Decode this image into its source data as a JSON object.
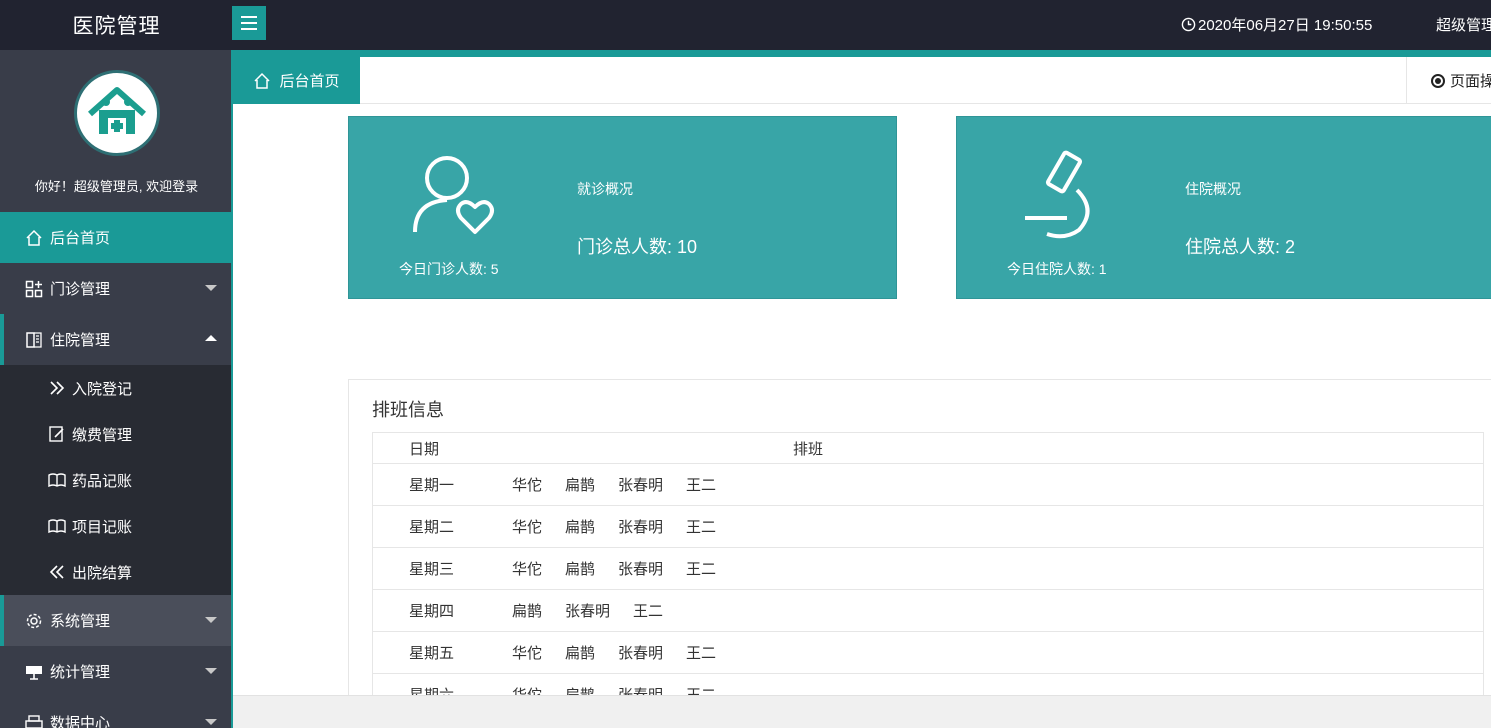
{
  "app": {
    "title": "医院管理",
    "clock": "2020年06月27日 19:50:55",
    "user": "超级管理"
  },
  "sidebar": {
    "welcome": "你好！超级管理员, 欢迎登录",
    "items": [
      {
        "label": "后台首页",
        "icon": "home-icon"
      },
      {
        "label": "门诊管理",
        "icon": "grid-icon"
      },
      {
        "label": "住院管理",
        "icon": "book-icon"
      },
      {
        "label": "系统管理",
        "icon": "gear-icon"
      },
      {
        "label": "统计管理",
        "icon": "board-icon"
      },
      {
        "label": "数据中心",
        "icon": "print-icon"
      }
    ],
    "subitems": [
      {
        "label": "入院登记",
        "icon": "double-chevron-right-icon"
      },
      {
        "label": "缴费管理",
        "icon": "edit-icon"
      },
      {
        "label": "药品记账",
        "icon": "open-book-icon"
      },
      {
        "label": "项目记账",
        "icon": "open-book-icon"
      },
      {
        "label": "出院结算",
        "icon": "double-chevron-left-icon"
      }
    ]
  },
  "tabs": {
    "home": "后台首页",
    "page_op": "页面操作"
  },
  "cards": [
    {
      "title": "就诊概况",
      "total": "门诊总人数: 10",
      "today": "今日门诊人数: 5",
      "icon": "user-heart-icon"
    },
    {
      "title": "住院概况",
      "total": "住院总人数: 2",
      "today": "今日住院人数: 1",
      "icon": "microscope-icon"
    }
  ],
  "schedule": {
    "title": "排班信息",
    "headers": [
      "日期",
      "排班"
    ],
    "rows": [
      {
        "day": "星期一",
        "doctors": [
          "华佗",
          "扁鹊",
          "张春明",
          "王二"
        ]
      },
      {
        "day": "星期二",
        "doctors": [
          "华佗",
          "扁鹊",
          "张春明",
          "王二"
        ]
      },
      {
        "day": "星期三",
        "doctors": [
          "华佗",
          "扁鹊",
          "张春明",
          "王二"
        ]
      },
      {
        "day": "星期四",
        "doctors": [
          "扁鹊",
          "张春明",
          "王二"
        ]
      },
      {
        "day": "星期五",
        "doctors": [
          "华佗",
          "扁鹊",
          "张春明",
          "王二"
        ]
      },
      {
        "day": "星期六",
        "doctors": [
          "华佗",
          "扁鹊",
          "张春明",
          "王二"
        ]
      }
    ]
  },
  "colors": {
    "accent": "#1a9a97",
    "card": "#38a5a7",
    "topbar": "#212330",
    "sidebar": "#393d49",
    "submenu": "#282b33"
  }
}
